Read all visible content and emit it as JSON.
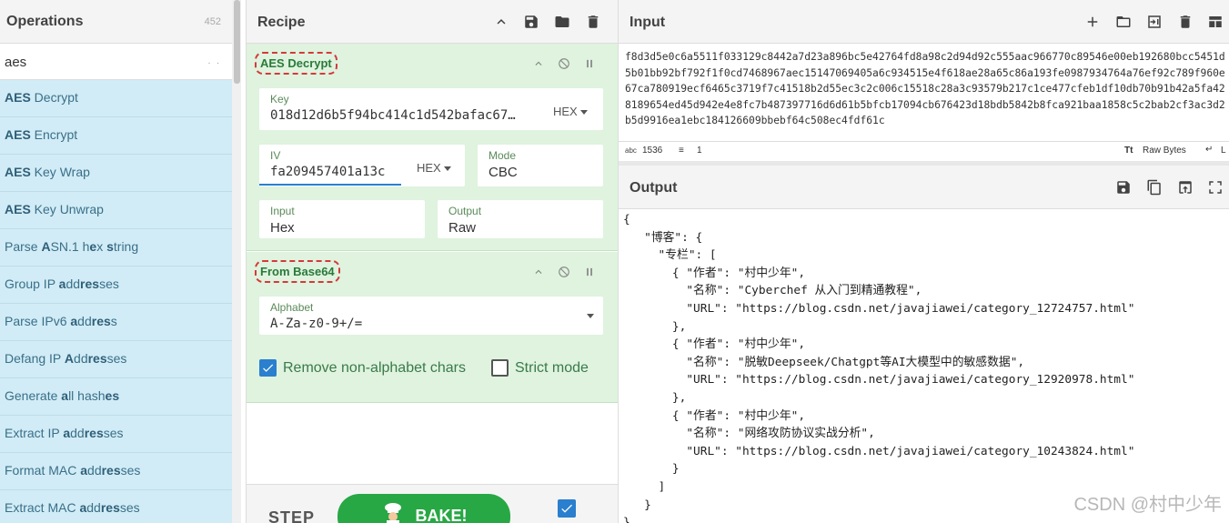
{
  "operations": {
    "title": "Operations",
    "count": "452",
    "search_value": "aes",
    "search_hint": ". .",
    "items": [
      {
        "pre": "",
        "bold": "AES",
        "post": " Decrypt"
      },
      {
        "pre": "",
        "bold": "AES",
        "post": " Encrypt"
      },
      {
        "pre": "",
        "bold": "AES",
        "post": " Key Wrap"
      },
      {
        "pre": "",
        "bold": "AES",
        "post": " Key Unwrap"
      },
      {
        "pre": "Parse ",
        "bold": "A",
        "post": "SN.1 h",
        "bold2": "e",
        "post2": "x ",
        "bold3": "s",
        "post3": "tring"
      },
      {
        "pre": "Group IP ",
        "bold": "a",
        "post": "dd",
        "bold2": "res",
        "post2": "ses"
      },
      {
        "pre": "Parse IPv6 ",
        "bold": "a",
        "post": "dd",
        "bold2": "res",
        "post2": "s"
      },
      {
        "pre": "Defang IP ",
        "bold": "A",
        "post": "dd",
        "bold2": "res",
        "post2": "ses"
      },
      {
        "pre": "Generate ",
        "bold": "a",
        "post": "ll hash",
        "bold2": "es",
        "post2": ""
      },
      {
        "pre": "Extract IP ",
        "bold": "a",
        "post": "dd",
        "bold2": "res",
        "post2": "ses"
      },
      {
        "pre": "Format MAC ",
        "bold": "a",
        "post": "dd",
        "bold2": "res",
        "post2": "ses"
      },
      {
        "pre": "Extract MAC ",
        "bold": "a",
        "post": "dd",
        "bold2": "res",
        "post2": "ses"
      }
    ]
  },
  "recipe": {
    "title": "Recipe",
    "aes_decrypt": {
      "name": "AES Decrypt",
      "key_label": "Key",
      "key_value": "018d12d6b5f94bc414c1d542bafac67…",
      "key_format": "HEX",
      "iv_label": "IV",
      "iv_value": "fa209457401a13c",
      "iv_format": "HEX",
      "mode_label": "Mode",
      "mode_value": "CBC",
      "input_label": "Input",
      "input_value": "Hex",
      "output_label": "Output",
      "output_value": "Raw"
    },
    "from_base64": {
      "name": "From Base64",
      "alphabet_label": "Alphabet",
      "alphabet_value": "A-Za-z0-9+/=",
      "remove_label": "Remove non-alphabet chars",
      "strict_label": "Strict mode"
    },
    "step_label": "STEP",
    "bake_label": "BAKE!"
  },
  "input": {
    "title": "Input",
    "text": "f8d3d5e0c6a5511f033129c8442a7d23a896bc5e42764fd8a98c2d94d92c555aac966770c89546e00eb192680bcc5451d5b01bb92bf792f1f0cd7468967aec15147069405a6c934515e4f618ae28a65c86a193fe0987934764a76ef92c789f960e67ca780919ecf6465c3719f7c41518b2d55ec3c2c006c15518c28a3c93579b217c1ce477cfeb1df10db70b91b42a5fa428189654ed45d942e4e8fc7b487397716d6d61b5bfcb17094cb676423d18bdb5842b8fca921baa1858c5c2bab2cf3ac3d2b5d9916ea1ebc184126609bbebf64c508ec4fdf61c",
    "length": "1536",
    "lines": "1",
    "encoding": "Raw Bytes",
    "eol": "L"
  },
  "output": {
    "title": "Output",
    "text": "{\n   \"博客\": {\n     \"专栏\": [\n       { \"作者\": \"村中少年\",\n         \"名称\": \"Cyberchef 从入门到精通教程\",\n         \"URL\": \"https://blog.csdn.net/javajiawei/category_12724757.html\"\n       },\n       { \"作者\": \"村中少年\",\n         \"名称\": \"脱敏Deepseek/Chatgpt等AI大模型中的敏感数据\",\n         \"URL\": \"https://blog.csdn.net/javajiawei/category_12920978.html\"\n       },\n       { \"作者\": \"村中少年\",\n         \"名称\": \"网络攻防协议实战分析\",\n         \"URL\": \"https://blog.csdn.net/javajiawei/category_10243824.html\"\n       }\n     ]\n   }\n}"
  },
  "watermark": "CSDN @村中少年",
  "colors": {
    "op_item_bg": "#d1ecf6",
    "recipe_block_bg": "#dff3df",
    "bake_green": "#28a745",
    "checkbox_blue": "#2a7fce",
    "highlight_dash": "#d43a3a"
  }
}
